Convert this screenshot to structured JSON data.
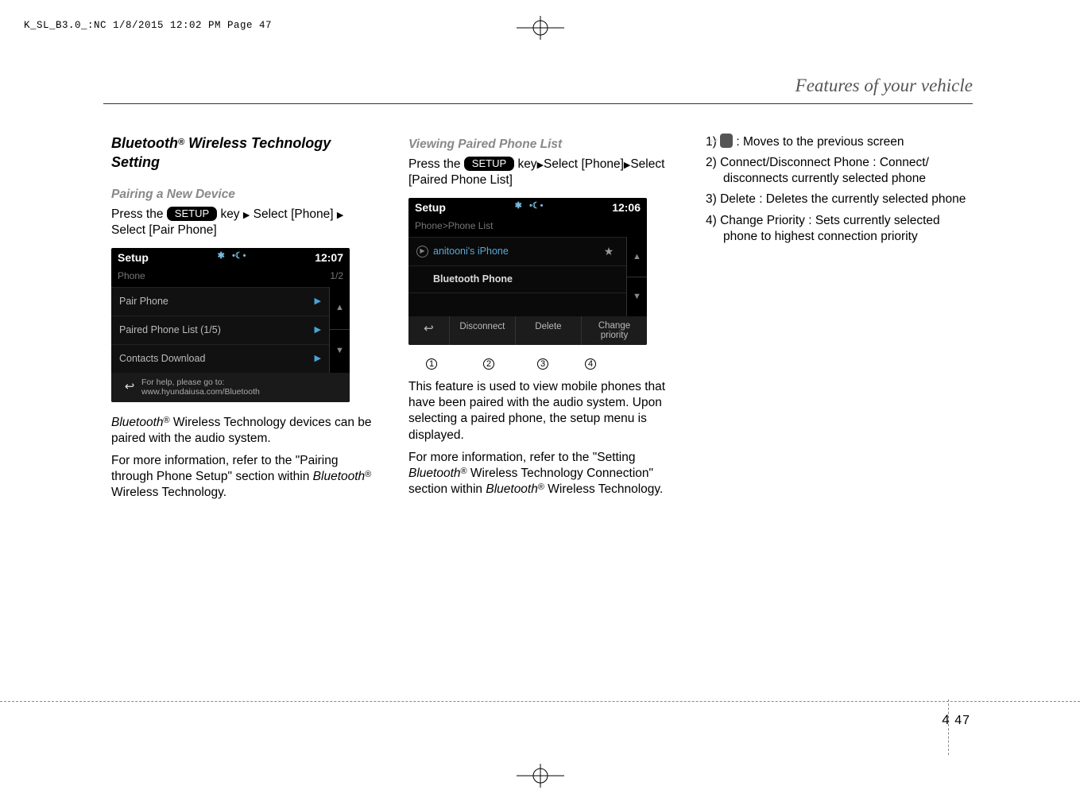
{
  "header": {
    "file_info": "K_SL_B3.0_:NC  1/8/2015  12:02 PM  Page 47"
  },
  "chapter_title": "Features of your vehicle",
  "col1": {
    "heading_pre": "Bluetooth",
    "heading_reg": "®",
    "heading_post": "  Wireless Technology Setting",
    "sub": "Pairing a New Device",
    "press_the": "Press  the  ",
    "setup_label": "SETUP",
    "key_select": "  key",
    "select_text": "Select",
    "phone_pair": "[Phone]",
    "select_pair": "Select [Pair Phone]",
    "screenshot": {
      "title": "Setup",
      "clock": "12:07",
      "sub": "Phone",
      "page": "1/2",
      "row1": "Pair Phone",
      "row2": "Paired Phone List (1/5)",
      "row3": "Contacts Download",
      "help1": "For help, please go to:",
      "help2": "www.hyundaiusa.com/Bluetooth"
    },
    "para1_a": "Bluetooth",
    "para1_b": "  Wireless Technology devices can be paired with the audio system.",
    "para2": "For more information, refer to the \"Pairing through Phone Setup\" section within ",
    "para2_b": "Bluetooth",
    "para2_c": "  Wireless Technology."
  },
  "col2": {
    "sub": "Viewing Paired Phone List",
    "press_the": "Press  the  ",
    "setup_label": "SETUP",
    "key": "  key",
    "select": "Select",
    "phone": "[Phone]",
    "select_list": "Select [Paired Phone List]",
    "screenshot": {
      "title": "Setup",
      "clock": "12:06",
      "sub": "Phone>Phone List",
      "row1": "anitooni's iPhone",
      "row2": "Bluetooth Phone",
      "btn_disconnect": "Disconnect",
      "btn_delete": "Delete",
      "btn_change1": "Change",
      "btn_change2": "priority"
    },
    "para1": "This feature is used to view mobile phones that have been paired with the audio system. Upon selecting a paired phone, the setup menu is displayed.",
    "para2_a": "For more information, refer to the \"Setting ",
    "para2_b": "Bluetooth",
    "para2_c": "  Wireless Technology Connection\" section within ",
    "para2_d": "Bluetooth",
    "para2_e": " Wireless Technology."
  },
  "col3": {
    "item1_a": "1) ",
    "item1_b": " : Moves to the previous screen",
    "item2": "2) Connect/Disconnect  Phone  : Connect/ disconnects currently selected phone",
    "item3": "3) Delete : Deletes the currently selected phone",
    "item4": "4) Change Priority : Sets currently selected phone to highest connection priority"
  },
  "page_number": {
    "section": "4",
    "page": "47"
  }
}
